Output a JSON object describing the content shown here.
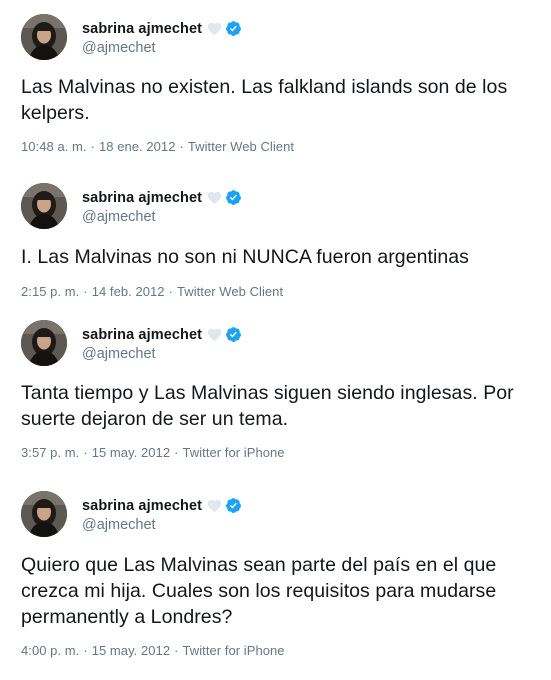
{
  "colors": {
    "text": "#14171a",
    "secondary": "#657786",
    "verified": "#1da1f2",
    "heart": "#e1e8ed",
    "divider": "#e6ecf0"
  },
  "tweets": [
    {
      "display_name": "sabrina ajmechet",
      "handle": "@ajmechet",
      "text": "Las Malvinas no existen. Las falkland islands son de los kelpers.",
      "time": "10:48 a. m.",
      "date": "18 ene. 2012",
      "source": "Twitter Web Client",
      "icons": [
        "avatar-photo",
        "white-heart-icon",
        "verified-badge-icon"
      ]
    },
    {
      "display_name": "sabrina ajmechet",
      "handle": "@ajmechet",
      "text": "I. Las Malvinas no son ni NUNCA fueron argentinas",
      "time": "2:15 p. m.",
      "date": "14 feb. 2012",
      "source": "Twitter Web Client",
      "icons": [
        "avatar-photo",
        "white-heart-icon",
        "verified-badge-icon"
      ]
    },
    {
      "display_name": "sabrina ajmechet",
      "handle": "@ajmechet",
      "text": "Tanta tiempo y Las Malvinas siguen siendo inglesas. Por suerte dejaron de ser un tema.",
      "time": "3:57 p. m.",
      "date": "15 may. 2012",
      "source": "Twitter for iPhone",
      "icons": [
        "avatar-photo",
        "white-heart-icon",
        "verified-badge-icon"
      ]
    },
    {
      "display_name": "sabrina ajmechet",
      "handle": "@ajmechet",
      "text": "Quiero que Las Malvinas sean parte del país en el que crezca mi hija. Cuales son los requisitos para mudarse permanently a Londres?",
      "time": "4:00 p. m.",
      "date": "15 may. 2012",
      "source": "Twitter for iPhone",
      "icons": [
        "avatar-photo",
        "white-heart-icon",
        "verified-badge-icon"
      ]
    }
  ],
  "separator": "·"
}
